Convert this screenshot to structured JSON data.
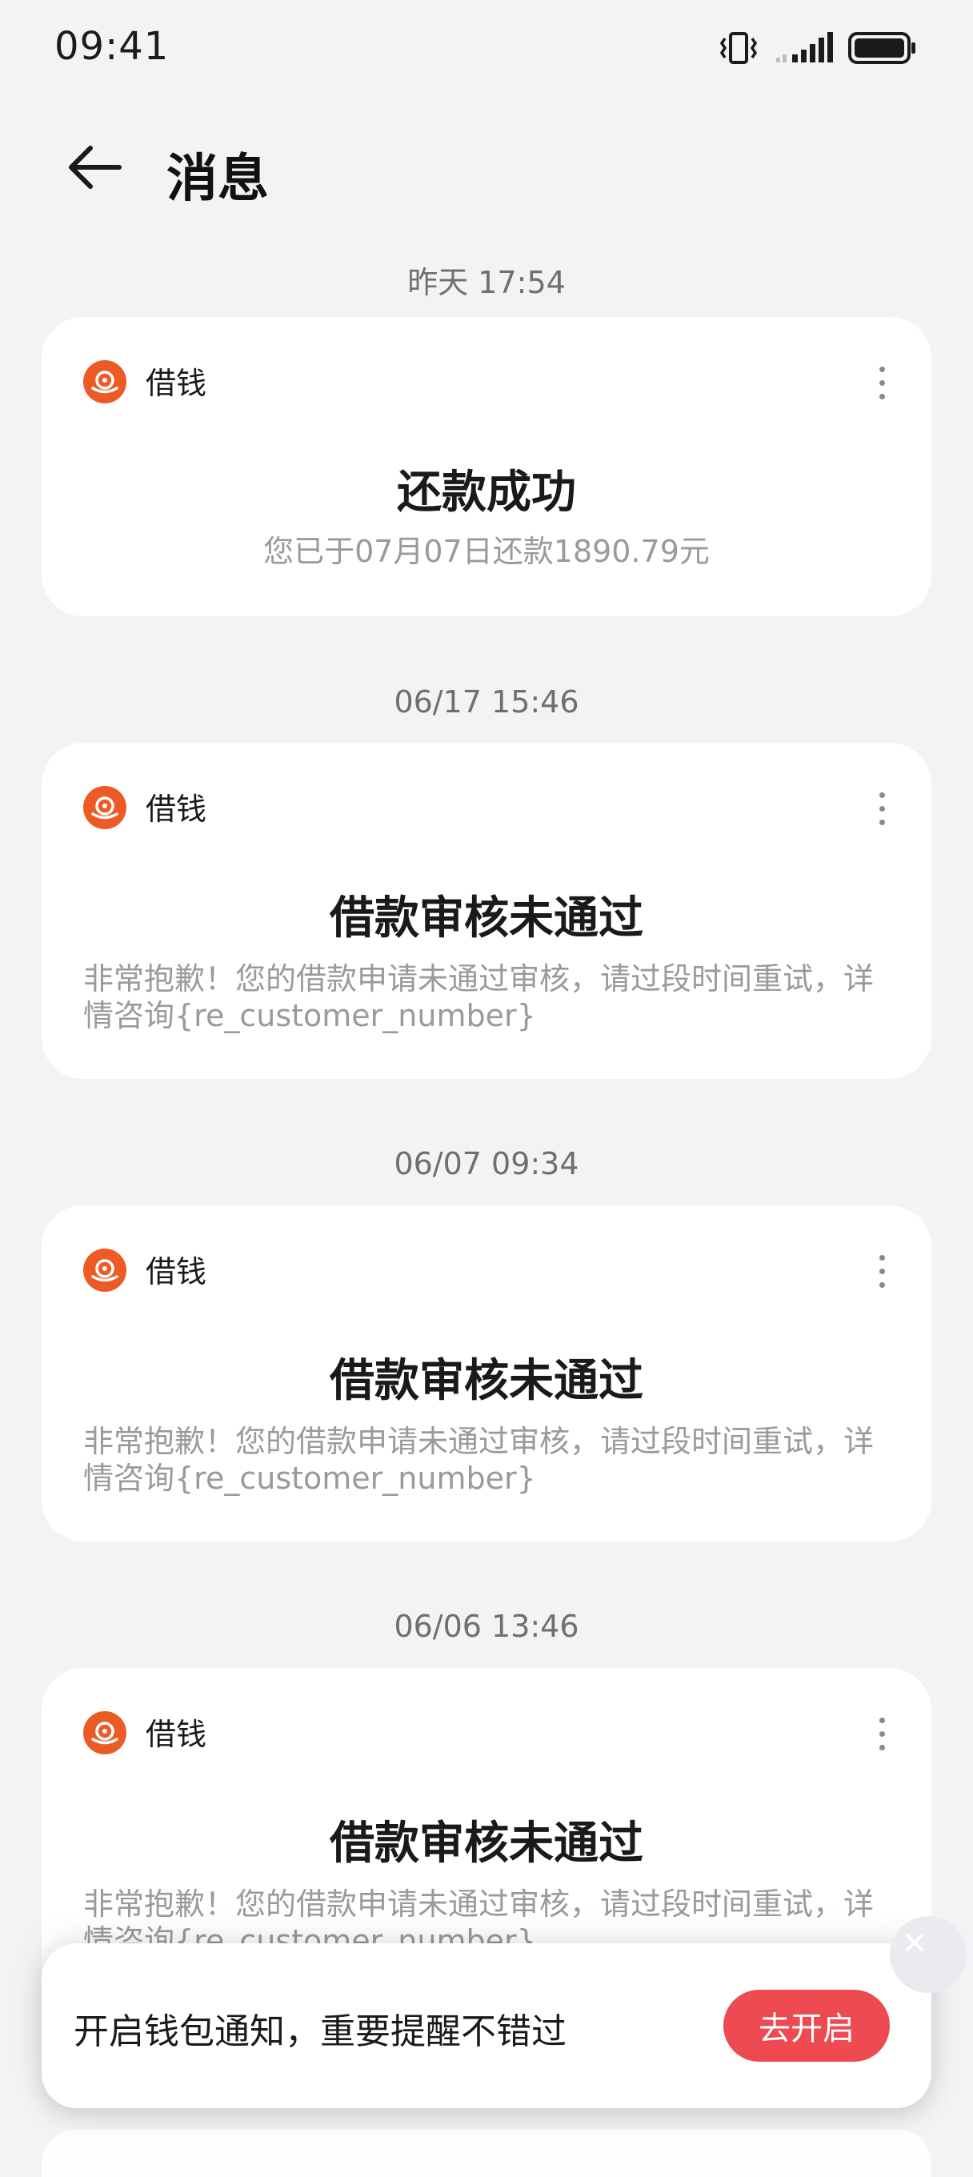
{
  "status_bar": {
    "time": "09:41"
  },
  "header": {
    "title": "消息"
  },
  "messages": [
    {
      "time": "昨天 17:54",
      "app": "借钱",
      "title": "还款成功",
      "body": "您已于07月07日还款1890.79元"
    },
    {
      "time": "06/17 15:46",
      "app": "借钱",
      "title": "借款审核未通过",
      "body": "非常抱歉！您的借款申请未通过审核，请过段时间重试，详情咨询{re_customer_number}"
    },
    {
      "time": "06/07 09:34",
      "app": "借钱",
      "title": "借款审核未通过",
      "body": "非常抱歉！您的借款申请未通过审核，请过段时间重试，详情咨询{re_customer_number}"
    },
    {
      "time": "06/06 13:46",
      "app": "借钱",
      "title": "借款审核未通过",
      "body": "非常抱歉！您的借款申请未通过审核，请过段时间重试，详情咨询{re_customer_number}"
    }
  ],
  "banner": {
    "text": "开启钱包通知，重要提醒不错过",
    "button": "去开启"
  },
  "colors": {
    "app_icon": "#ec5b26",
    "button": "#ee4a52",
    "background": "#f1f3f5"
  },
  "icons": {
    "back": "arrow-left-icon",
    "more": "more-vertical-icon",
    "close": "close-icon",
    "vibrate": "vibrate-icon",
    "signal": "signal-icon",
    "battery": "battery-icon"
  }
}
